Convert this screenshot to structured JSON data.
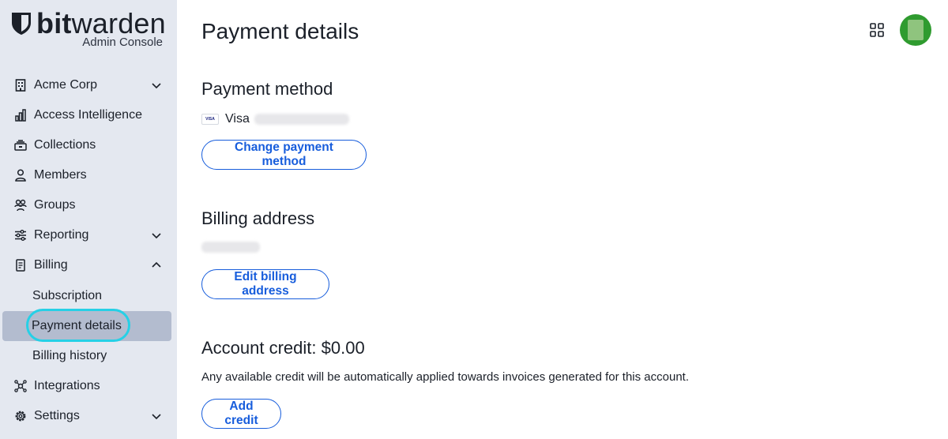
{
  "app": {
    "brand_bold": "bit",
    "brand_rest": "warden",
    "subtitle": "Admin Console"
  },
  "sidebar": {
    "items": [
      {
        "label": "Acme Corp",
        "icon": "building-icon",
        "chevron": "down"
      },
      {
        "label": "Access Intelligence",
        "icon": "bar-chart-icon"
      },
      {
        "label": "Collections",
        "icon": "collections-icon"
      },
      {
        "label": "Members",
        "icon": "user-icon"
      },
      {
        "label": "Groups",
        "icon": "users-icon"
      },
      {
        "label": "Reporting",
        "icon": "sliders-icon",
        "chevron": "down"
      },
      {
        "label": "Billing",
        "icon": "receipt-icon",
        "chevron": "up"
      },
      {
        "label": "Integrations",
        "icon": "integrations-icon"
      },
      {
        "label": "Settings",
        "icon": "gear-icon",
        "chevron": "down"
      }
    ],
    "billing_sub": [
      "Subscription",
      "Payment details",
      "Billing history"
    ],
    "active_sub": "Payment details"
  },
  "main": {
    "title": "Payment details",
    "payment_method": {
      "heading": "Payment method",
      "card_brand": "Visa",
      "button": "Change payment method"
    },
    "billing_address": {
      "heading": "Billing address",
      "button": "Edit billing address"
    },
    "account_credit": {
      "heading": "Account credit: $0.00",
      "description": "Any available credit will be automatically applied towards invoices generated for this account.",
      "button": "Add credit"
    }
  },
  "colors": {
    "sidebar_bg": "#e4e8f0",
    "active_bg": "#b3bccf",
    "accent": "#175ddc",
    "focus_ring": "#26d0e6",
    "avatar": "#2f9b2f"
  }
}
